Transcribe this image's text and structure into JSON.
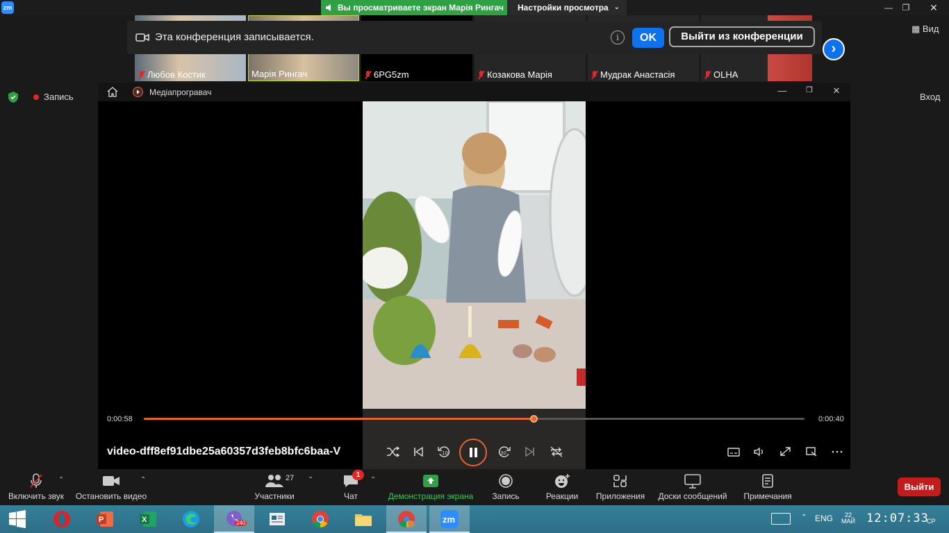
{
  "zoom": {
    "logo": "zm",
    "share_banner": "Вы просматриваете экран Марія Рингач",
    "view_settings": "Настройки просмотра",
    "view_button": "Вид",
    "recording_label": "Запись",
    "login": "Вход",
    "recording_notice": {
      "text": "Эта конференция записывается.",
      "info": "i",
      "ok": "OK",
      "leave": "Выйти из конференции"
    },
    "participants": [
      {
        "name": "Любов Костик",
        "muted": true
      },
      {
        "name": "Марія Рингач",
        "muted": false
      },
      {
        "name": "6PG5zm",
        "muted": true
      },
      {
        "name": "Козакова Марія",
        "muted": true
      },
      {
        "name": "Мудрак Анастасія",
        "muted": true
      },
      {
        "name": "OLHA",
        "muted": true
      }
    ],
    "toolbar": {
      "unmute": "Включить звук",
      "stop_video": "Остановить видео",
      "participants": "Участники",
      "participants_count": "27",
      "chat": "Чат",
      "chat_badge": "1",
      "share_screen": "Демонстрация экрана",
      "record": "Запись",
      "reactions": "Реакции",
      "apps": "Приложения",
      "whiteboards": "Доски сообщений",
      "notes": "Примечания",
      "leave": "Выйти"
    },
    "colors": {
      "accent": "#0e72ed",
      "share_green": "#2fa043",
      "leave_red": "#c21d1d"
    }
  },
  "player": {
    "app_title": "Медіапрогравач",
    "file_name": "video-dff8ef91dbe25a60357d3feb8bfc6baa-V",
    "time_current": "0:00:58",
    "time_total": "0:00:40",
    "progress": 0.59,
    "accent": "#e8632b"
  },
  "taskbar": {
    "apps": [
      "windows-start",
      "opera",
      "powerpoint",
      "excel",
      "edge",
      "viber",
      "news",
      "chrome",
      "file-explorer",
      "chrome-profile",
      "zoom"
    ],
    "viber_badge": "240",
    "language": "ENG",
    "date_top": "22",
    "date_bottom": "МАЙ",
    "time": "12:07:33",
    "day": "СР"
  }
}
